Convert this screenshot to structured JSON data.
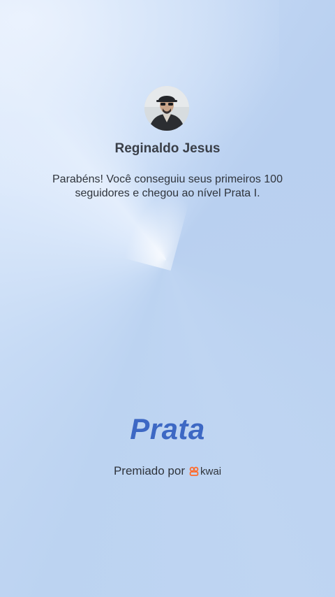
{
  "profile": {
    "name": "Reginaldo Jesus"
  },
  "message": {
    "line1": "Parabéns! Você conseguiu seus primeiros 100",
    "line2": "seguidores e chegou ao nível Prata I."
  },
  "level": {
    "title": "Prata"
  },
  "footer": {
    "awarded_label": "Premiado por",
    "brand_name": "kwai",
    "brand_icon": "kwai-logo-icon",
    "brand_color": "#ff6a2b"
  },
  "colors": {
    "level_title": "#3d68c4",
    "background": "#b9d0ef"
  }
}
